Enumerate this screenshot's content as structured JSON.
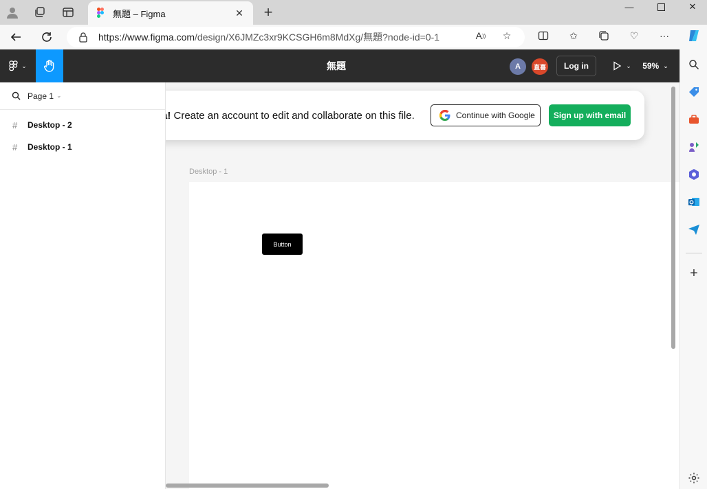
{
  "browser": {
    "tab": {
      "title": "無題 – Figma"
    },
    "url": {
      "host": "https://www.figma.com",
      "rest": "/design/X6JMZc3xr9KCSGH6m8MdXg/無題?node-id=0-1"
    },
    "icons": {
      "profile": "profile-icon",
      "workspaces": "workspaces-icon",
      "tab_actions": "tab-actions-icon",
      "back": "back-icon",
      "refresh": "refresh-icon",
      "lock": "lock-icon",
      "read_aloud": "read-aloud-icon",
      "favorite": "star-icon",
      "split": "split-screen-icon",
      "favorites": "favorites-icon",
      "collections": "collections-icon",
      "health": "browser-essentials-icon",
      "more": "more-icon",
      "copilot": "copilot-icon"
    }
  },
  "figma": {
    "file_title": "無題",
    "avatars": [
      {
        "initial": "A",
        "color": "#6c7aa8"
      },
      {
        "initial": "直喜",
        "color": "#d9482b"
      }
    ],
    "login_label": "Log in",
    "zoom": "59%",
    "page_label": "Page 1",
    "layers": [
      {
        "name": "Desktop - 2"
      },
      {
        "name": "Desktop - 1"
      }
    ],
    "banner": {
      "bold": "a!",
      "text": " Create an account to edit and collaborate on this file.",
      "google_label": "Continue with Google",
      "signup_label": "Sign up with email"
    },
    "frame_label": "Desktop - 1",
    "frame_button_label": "Button"
  },
  "colors": {
    "toolbar_bg": "#2c2c2c",
    "active_tool": "#0d99ff",
    "signup_green": "#14ae5c"
  }
}
